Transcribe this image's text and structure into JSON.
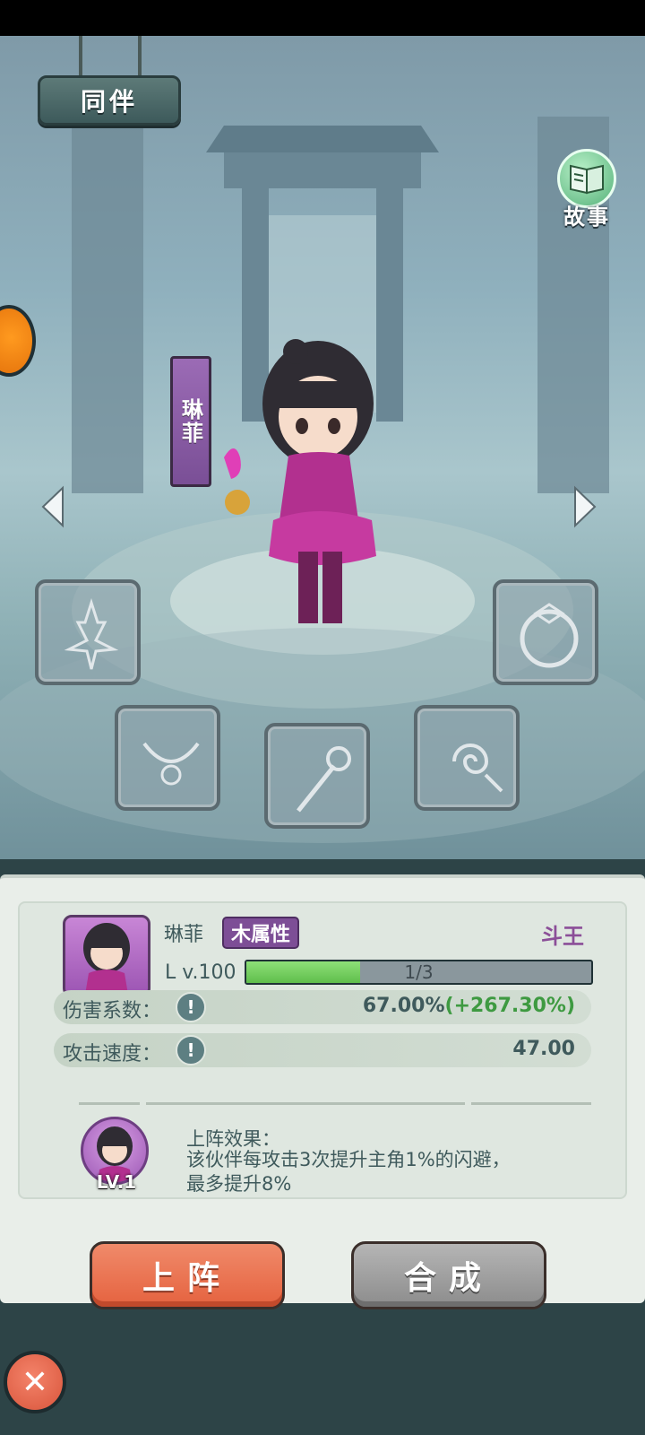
{
  "header": {
    "title": "同伴"
  },
  "story_button": {
    "label": "故事",
    "icon": "book-icon"
  },
  "hero": {
    "name": "琳菲",
    "attribute": "木属性",
    "rank": "斗王",
    "level": "L v.100",
    "xp_text": "1/3",
    "xp_progress": 0.33
  },
  "stats": [
    {
      "label": "伤害系数：",
      "value": "67.00%",
      "bonus": "(+267.30%)"
    },
    {
      "label": "攻击速度：",
      "value": "47.00",
      "bonus": ""
    }
  ],
  "skill": {
    "level": "LV.1",
    "title": "上阵效果：",
    "line1": "该伙伴每攻击3次提升主角1%的闪避，",
    "line2": "最多提升8%"
  },
  "buttons": {
    "deploy": "上阵",
    "merge": "合成"
  },
  "equipment_slots": [
    "weapon-slot",
    "ring-slot",
    "necklace-slot",
    "staff-slot",
    "amulet-slot"
  ],
  "colors": {
    "accent_purple": "#7d4e96",
    "deploy": "#e5623f",
    "merge": "#8c8c8c",
    "bonus_green": "#3e9a41"
  }
}
